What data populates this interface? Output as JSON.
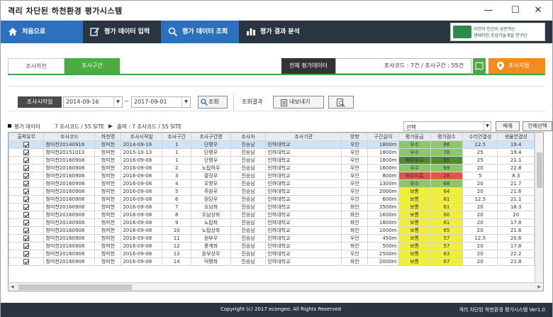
{
  "window": {
    "title": "격리 차단된 하천환경 평가시스템",
    "min": "—",
    "max": "☐",
    "close": "✕"
  },
  "nav": {
    "home": "처음으로",
    "items": [
      "평가 데이터 입력",
      "평가 데이터 조회",
      "평가 결과 분석"
    ],
    "logo_line1": "자연과 인간이 공존하는",
    "logo_line2": "생태하천 조성기술개발 연구단"
  },
  "tabs": {
    "river": "조사하천",
    "section": "조사구간"
  },
  "topbar": {
    "all_data_label": "전체 평가데이터",
    "summary": "조사코드 : 7건  /  조사구간 : 55건",
    "site_button": "조사지점"
  },
  "filter": {
    "start_label": "조사시작일",
    "date_from": "2014-09-16",
    "date_to": "2017-09-01",
    "tilde": "~",
    "query_button": "조회",
    "result_label": "조회결과",
    "export_button": "내보내기"
  },
  "info": {
    "title": "평가 데이터",
    "count": "7 조사코드 / 55 SITE",
    "output": "출력 : 7 조사코드 / 55 SITE",
    "select_value": "선택",
    "clear_button": "해제",
    "select_all_button": "전체선택"
  },
  "table": {
    "headers": [
      "출력유무",
      "조사코드",
      "하천명",
      "조사시작일",
      "조사구간",
      "조사구간명",
      "조사자",
      "조사기관",
      "방향",
      "구간길이",
      "평가등급",
      "평가점수",
      "수리연결성",
      "생물연결성"
    ],
    "rows": [
      [
        "",
        "청미천20140916",
        "청미천",
        "2014-09-16",
        "1",
        "단평우",
        "진승남",
        "인하대학교",
        "우안",
        "1800m",
        "우수",
        "66",
        "12.5",
        "19.4"
      ],
      [
        "",
        "청미천20151013",
        "청미천",
        "2015-10-13",
        "1",
        "단평우",
        "진승남",
        "인하대학교",
        "우안",
        "1800m",
        "우수",
        "78",
        "25",
        "19.4"
      ],
      [
        "",
        "청미천20160908",
        "청미천",
        "2016-09-08",
        "1",
        "단평우",
        "진승남",
        "인하대학교",
        "우안",
        "1800m",
        "매우우수",
        "85",
        "25",
        "21.1"
      ],
      [
        "",
        "청미천20160908",
        "청미천",
        "2016-09-08",
        "2",
        "노탑하우",
        "진승남",
        "인하대학교",
        "우안",
        "1600m",
        "우수",
        "69",
        "20",
        "22.8"
      ],
      [
        "",
        "청미천20160908",
        "청미천",
        "2016-09-08",
        "3",
        "황장우",
        "진승남",
        "인하대학교",
        "우안",
        "800m",
        "매우미흡",
        "26",
        "5",
        "8.3"
      ],
      [
        "",
        "청미천20160908",
        "청미천",
        "2016-09-08",
        "4",
        "오향우",
        "진승남",
        "인하대학교",
        "우안",
        "1300m",
        "우수",
        "68",
        "20",
        "21.7"
      ],
      [
        "",
        "청미천20160908",
        "청미천",
        "2016-09-08",
        "5",
        "주원우",
        "진승남",
        "인하대학교",
        "우안",
        "2000m",
        "보통",
        "64",
        "20",
        "21.6"
      ],
      [
        "",
        "청미천20160908",
        "청미천",
        "2016-09-08",
        "6",
        "원당우",
        "진승남",
        "인하대학교",
        "우안",
        "600m",
        "보통",
        "61",
        "12.5",
        "21.1"
      ],
      [
        "",
        "청미천20160908",
        "청미천",
        "2016-09-08",
        "7",
        "오남좌",
        "진승남",
        "인하대학교",
        "좌안",
        "3500m",
        "보통",
        "61",
        "20",
        "18.3"
      ],
      [
        "",
        "청미천20160908",
        "청미천",
        "2016-09-08",
        "8",
        "오남상좌",
        "진승남",
        "인하대학교",
        "좌안",
        "1600m",
        "보통",
        "60",
        "20",
        "20"
      ],
      [
        "",
        "청미천20160908",
        "청미천",
        "2016-09-08",
        "9",
        "노탑좌",
        "진승남",
        "인하대학교",
        "좌안",
        "1800m",
        "보통",
        "61",
        "20",
        "17.8"
      ],
      [
        "",
        "청미천20160908",
        "청미천",
        "2016-09-08",
        "10",
        "노탑상좌",
        "진승남",
        "인하대학교",
        "좌안",
        "1000m",
        "보통",
        "65",
        "20",
        "21.6"
      ],
      [
        "",
        "청미천20160908",
        "청미천",
        "2016-09-08",
        "11",
        "원부우",
        "진승남",
        "인하대학교",
        "우안",
        "450m",
        "보통",
        "57",
        "12.5",
        "20.6"
      ],
      [
        "",
        "청미천20160908",
        "청미천",
        "2016-09-08",
        "12",
        "풍계좌",
        "진승남",
        "인하대학교",
        "좌안",
        "500m",
        "보통",
        "57",
        "20",
        "17.8"
      ],
      [
        "",
        "청미천20160908",
        "청미천",
        "2016-09-08",
        "13",
        "원부상우",
        "진승남",
        "인하대학교",
        "우안",
        "2500m",
        "보통",
        "63",
        "20",
        "22.2"
      ],
      [
        "",
        "청미천20160908",
        "청미천",
        "2016-09-08",
        "14",
        "덕평좌",
        "진승남",
        "인하대학교",
        "좌안",
        "2000m",
        "보통",
        "67",
        "20",
        "22.8"
      ]
    ],
    "grade_colors": {
      "우수": "#8ec46a",
      "매우우수": "#4f8a2e",
      "매우미흡": "#e0574a",
      "보통": "#f1ef3b"
    }
  },
  "footer": {
    "copyright": "Copyright (c) 2017 econgeo. All Rights Reserved",
    "app": "격리 차단된 하천환경 평가시스템   Ver1.0"
  },
  "colors": {
    "nav_bg": "#2b3542",
    "nav_active": "#2d6fbf",
    "green": "#4dac3f",
    "orange": "#f28c1e"
  }
}
